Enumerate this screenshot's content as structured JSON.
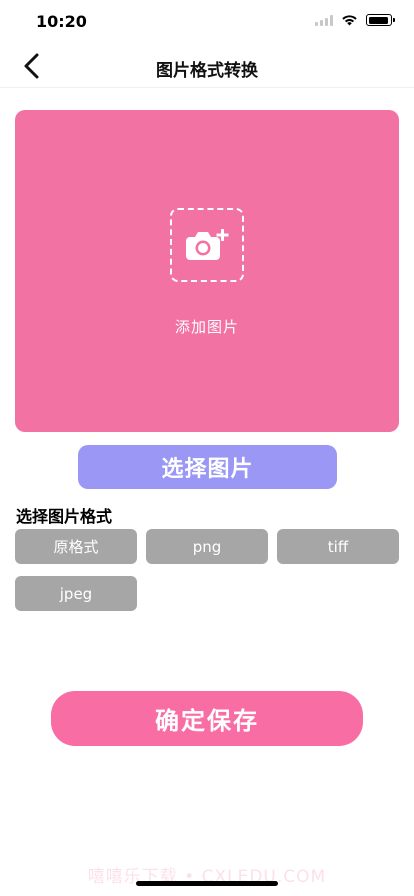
{
  "status_bar": {
    "time": "10:20",
    "icons": [
      "signal-icon",
      "wifi-icon",
      "battery-icon"
    ],
    "battery_level": 0.95
  },
  "nav": {
    "title": "图片格式转换",
    "back_icon": "chevron-left-icon"
  },
  "upload": {
    "icon": "camera-plus-icon",
    "label": "添加图片",
    "background_color": "#f272a3"
  },
  "select_button": {
    "label": "选择图片",
    "color": "#9a97f5"
  },
  "format_section": {
    "title": "选择图片格式",
    "options": [
      "原格式",
      "png",
      "tiff",
      "jpeg"
    ],
    "option_color": "#a6a6a6"
  },
  "save_button": {
    "label": "确定保存",
    "color": "#f86ea4"
  },
  "watermark": {
    "text": "嘻嘻乐下载 • CXLEDU.COM"
  }
}
